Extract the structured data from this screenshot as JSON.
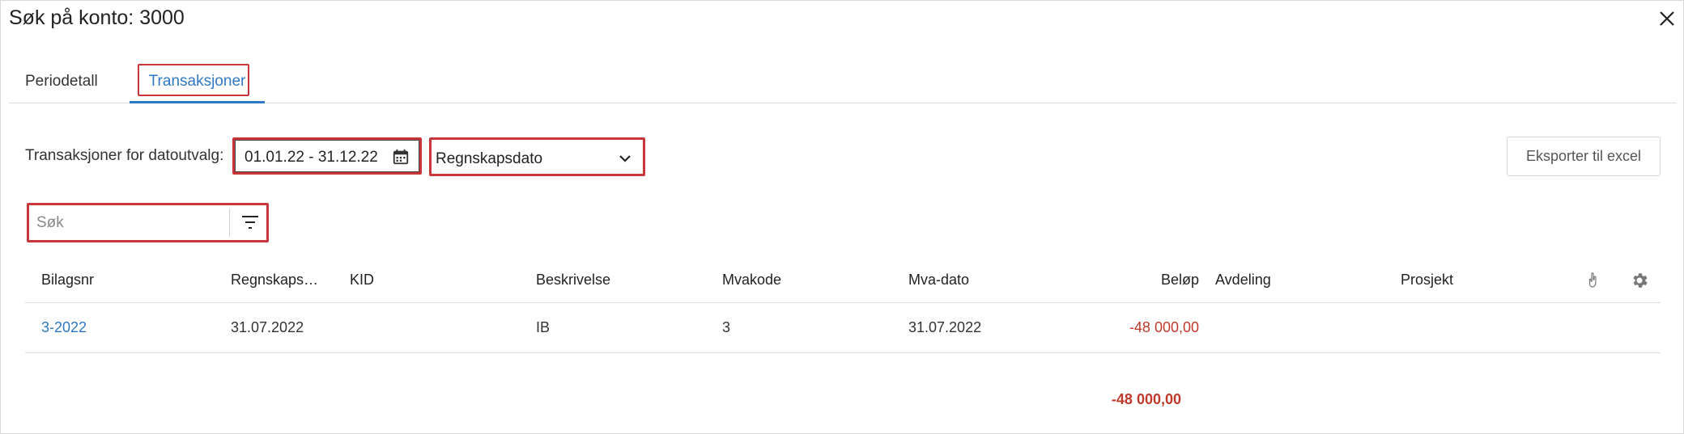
{
  "dialog": {
    "title": "Søk på konto: 3000",
    "close_icon": "close-icon"
  },
  "tabs": [
    {
      "label": "Periodetall",
      "active": false
    },
    {
      "label": "Transaksjoner",
      "active": true
    }
  ],
  "filters": {
    "date_label": "Transaksjoner for datoutvalg:",
    "date_range": "01.01.22 - 31.12.22",
    "date_type": "Regnskapsdato",
    "export_label": "Eksporter til excel",
    "search_placeholder": "Søk",
    "search_value": ""
  },
  "table": {
    "headers": [
      "Bilagsnr",
      "Regnskaps…",
      "KID",
      "Beskrivelse",
      "Mvakode",
      "Mva-dato",
      "Beløp",
      "Avdeling",
      "Prosjekt"
    ],
    "rows": [
      [
        "3-2022",
        "31.07.2022",
        "",
        "IB",
        "3",
        "31.07.2022",
        "-48 000,00",
        "",
        ""
      ]
    ],
    "total": "-48 000,00"
  },
  "colors": {
    "accent": "#2f78c4",
    "highlight": "#c8363a",
    "negative": "#c0392b"
  }
}
